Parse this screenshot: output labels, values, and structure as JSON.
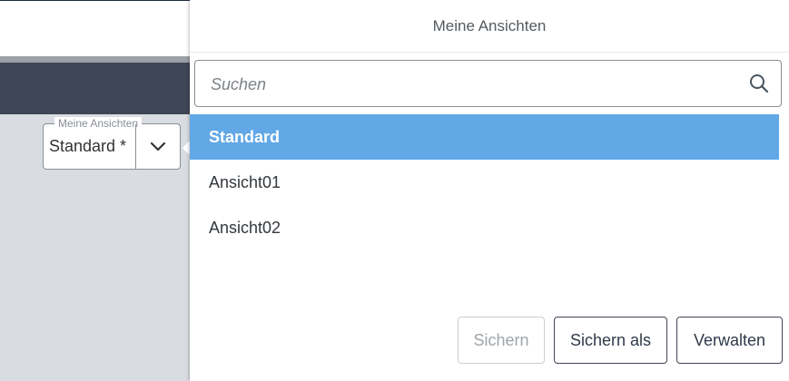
{
  "background": {
    "views_select": {
      "legend": "Meine Ansichten",
      "value": "Standard *"
    }
  },
  "panel": {
    "title": "Meine Ansichten",
    "search": {
      "placeholder": "Suchen",
      "value": ""
    },
    "items": [
      {
        "label": "Standard",
        "selected": true
      },
      {
        "label": "Ansicht01",
        "selected": false
      },
      {
        "label": "Ansicht02",
        "selected": false
      }
    ],
    "buttons": {
      "save": "Sichern",
      "save_as": "Sichern als",
      "manage": "Verwalten"
    }
  },
  "colors": {
    "selected_bg": "#62a8e6",
    "banner": "#3e4655"
  }
}
